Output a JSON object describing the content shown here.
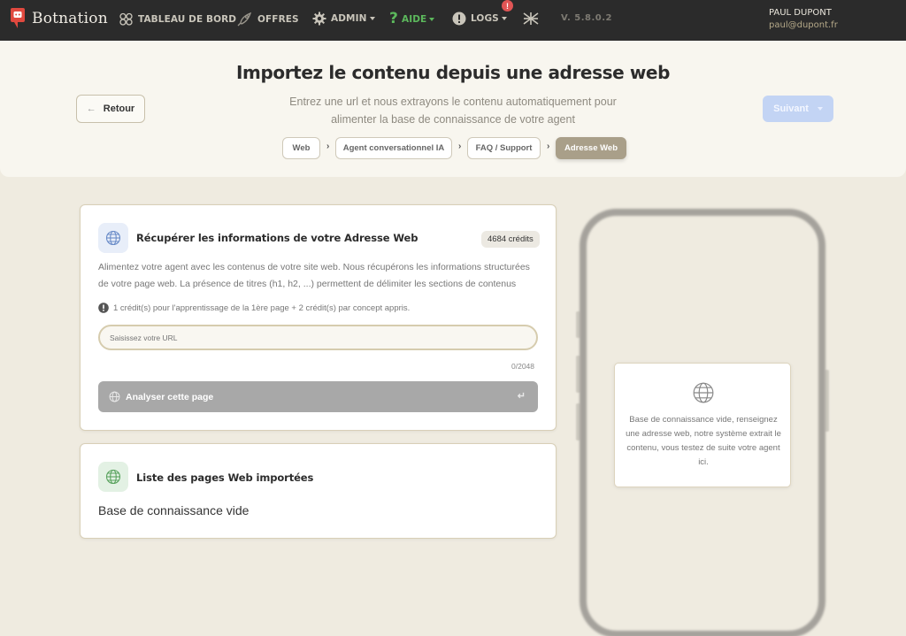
{
  "app": {
    "brand": "Botnation",
    "version": "V. 5.8.0.2"
  },
  "nav": {
    "dashboard": "TABLEAU DE BORD",
    "offers": "OFFRES",
    "admin": "ADMIN",
    "help": "AIDE",
    "logs": "LOGS",
    "logs_badge": "!"
  },
  "user": {
    "name": "PAUL DUPONT",
    "email": "paul@dupont.fr"
  },
  "header": {
    "title": "Importez le contenu depuis une adresse web",
    "subtitle": "Entrez une url et nous extrayons le contenu automatiquement pour alimenter la base de connaissance de votre agent",
    "back_label": "Retour",
    "next_label": "Suivant",
    "breadcrumb": [
      "Web",
      "Agent conversationnel IA",
      "FAQ / Support",
      "Adresse Web"
    ]
  },
  "import_card": {
    "title": "Récupérer les informations de votre Adresse Web",
    "credits": "4684 crédits",
    "description": "Alimentez votre agent avec les contenus de votre site web. Nous récupérons les informations structurées de votre page web. La présence de titres (h1, h2, ...) permettent de délimiter les sections de contenus",
    "info": "1 crédit(s) pour l'apprentissage de la 1ère page + 2 crédit(s) par concept appris.",
    "url_placeholder": "Saisissez votre URL",
    "url_value": "",
    "counter": "0/2048",
    "analyze_label": "Analyser cette page"
  },
  "list_card": {
    "title": "Liste des pages Web importées",
    "empty": "Base de connaissance vide"
  },
  "preview": {
    "text": "Base de connaissance vide, renseignez une adresse web, notre système extrait le contenu, vous testez de suite votre agent ici."
  },
  "colors": {
    "topbar": "#2b2b2b",
    "help_accent": "#5cb85c",
    "brand_red": "#e0493f",
    "active_crumb": "#a99f89",
    "next_button": "#c3d4f4"
  }
}
